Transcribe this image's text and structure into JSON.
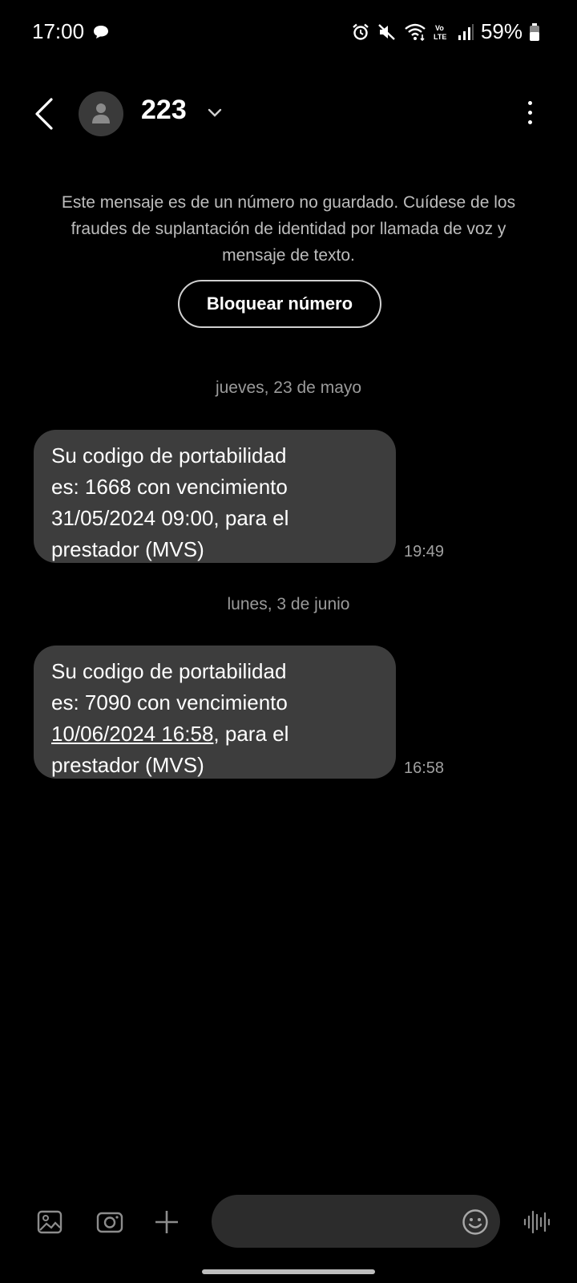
{
  "status_bar": {
    "time": "17:00",
    "battery": "59%",
    "network": "Vo LTE",
    "icons": [
      "chat-bubble-icon",
      "alarm-icon",
      "mute-icon",
      "wifi-icon",
      "volte-icon",
      "signal-icon",
      "battery-icon"
    ]
  },
  "header": {
    "contact_name": "223"
  },
  "warning": {
    "text": "Este mensaje es de un número no guardado. Cuídese de los fraudes de suplantación de identidad por llamada de voz y mensaje de texto.",
    "block_button": "Bloquear número"
  },
  "conversation": [
    {
      "date": "jueves, 23 de mayo",
      "lines": [
        "Su codigo de portabilidad",
        "es: 1668 con vencimiento",
        "31/05/2024 09:00, para el",
        "prestador (MVS)"
      ],
      "time": "19:49"
    },
    {
      "date": "lunes, 3 de junio",
      "lines": [
        "Su codigo de portabilidad",
        "es: 7090 con vencimiento",
        "10/06/2024 16:58",
        ", para el",
        "prestador (MVS)"
      ],
      "time": "16:58"
    }
  ],
  "input": {
    "placeholder": ""
  }
}
